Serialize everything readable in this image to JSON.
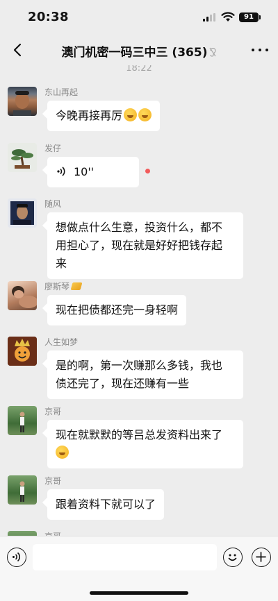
{
  "status_bar": {
    "time": "20:38",
    "battery": "91"
  },
  "nav": {
    "title": "澳门机密一码三中三 (365)",
    "back_icon": "chevron-left-icon",
    "more_icon": "ellipsis-icon",
    "mute_icon": "ear-icon"
  },
  "chat": {
    "timestamp": "18:22",
    "messages": [
      {
        "sender": "东山再起",
        "text": "今晚再接再厉",
        "emoji_count": 2
      },
      {
        "sender": "发仔",
        "type": "voice",
        "duration": "10''",
        "unread": true
      },
      {
        "sender": "随风",
        "lines": [
          "想做点什么生意，投资什么，都不",
          "用担心了，现在就是好好把钱存起",
          "来"
        ]
      },
      {
        "sender": "廖斯琴",
        "text": "现在把债都还完一身轻啊"
      },
      {
        "sender": "人生如梦",
        "lines": [
          "是的啊，第一次赚那么多钱，我也",
          "债还完了，现在还赚有一些"
        ]
      },
      {
        "sender": "京哥",
        "lines": [
          "现在就默默的等吕总发资料出来了"
        ],
        "trailing_emoji": true
      },
      {
        "sender": "京哥",
        "text": "跟着资料下就可以了"
      },
      {
        "sender": "京哥"
      }
    ]
  },
  "input_bar": {
    "placeholder": "",
    "voice_icon": "voice-input-icon",
    "emoji_icon": "emoji-icon",
    "plus_icon": "plus-icon"
  },
  "colors": {
    "background": "#ededed",
    "bubble": "#ffffff",
    "unread_dot": "#f25b5b"
  }
}
